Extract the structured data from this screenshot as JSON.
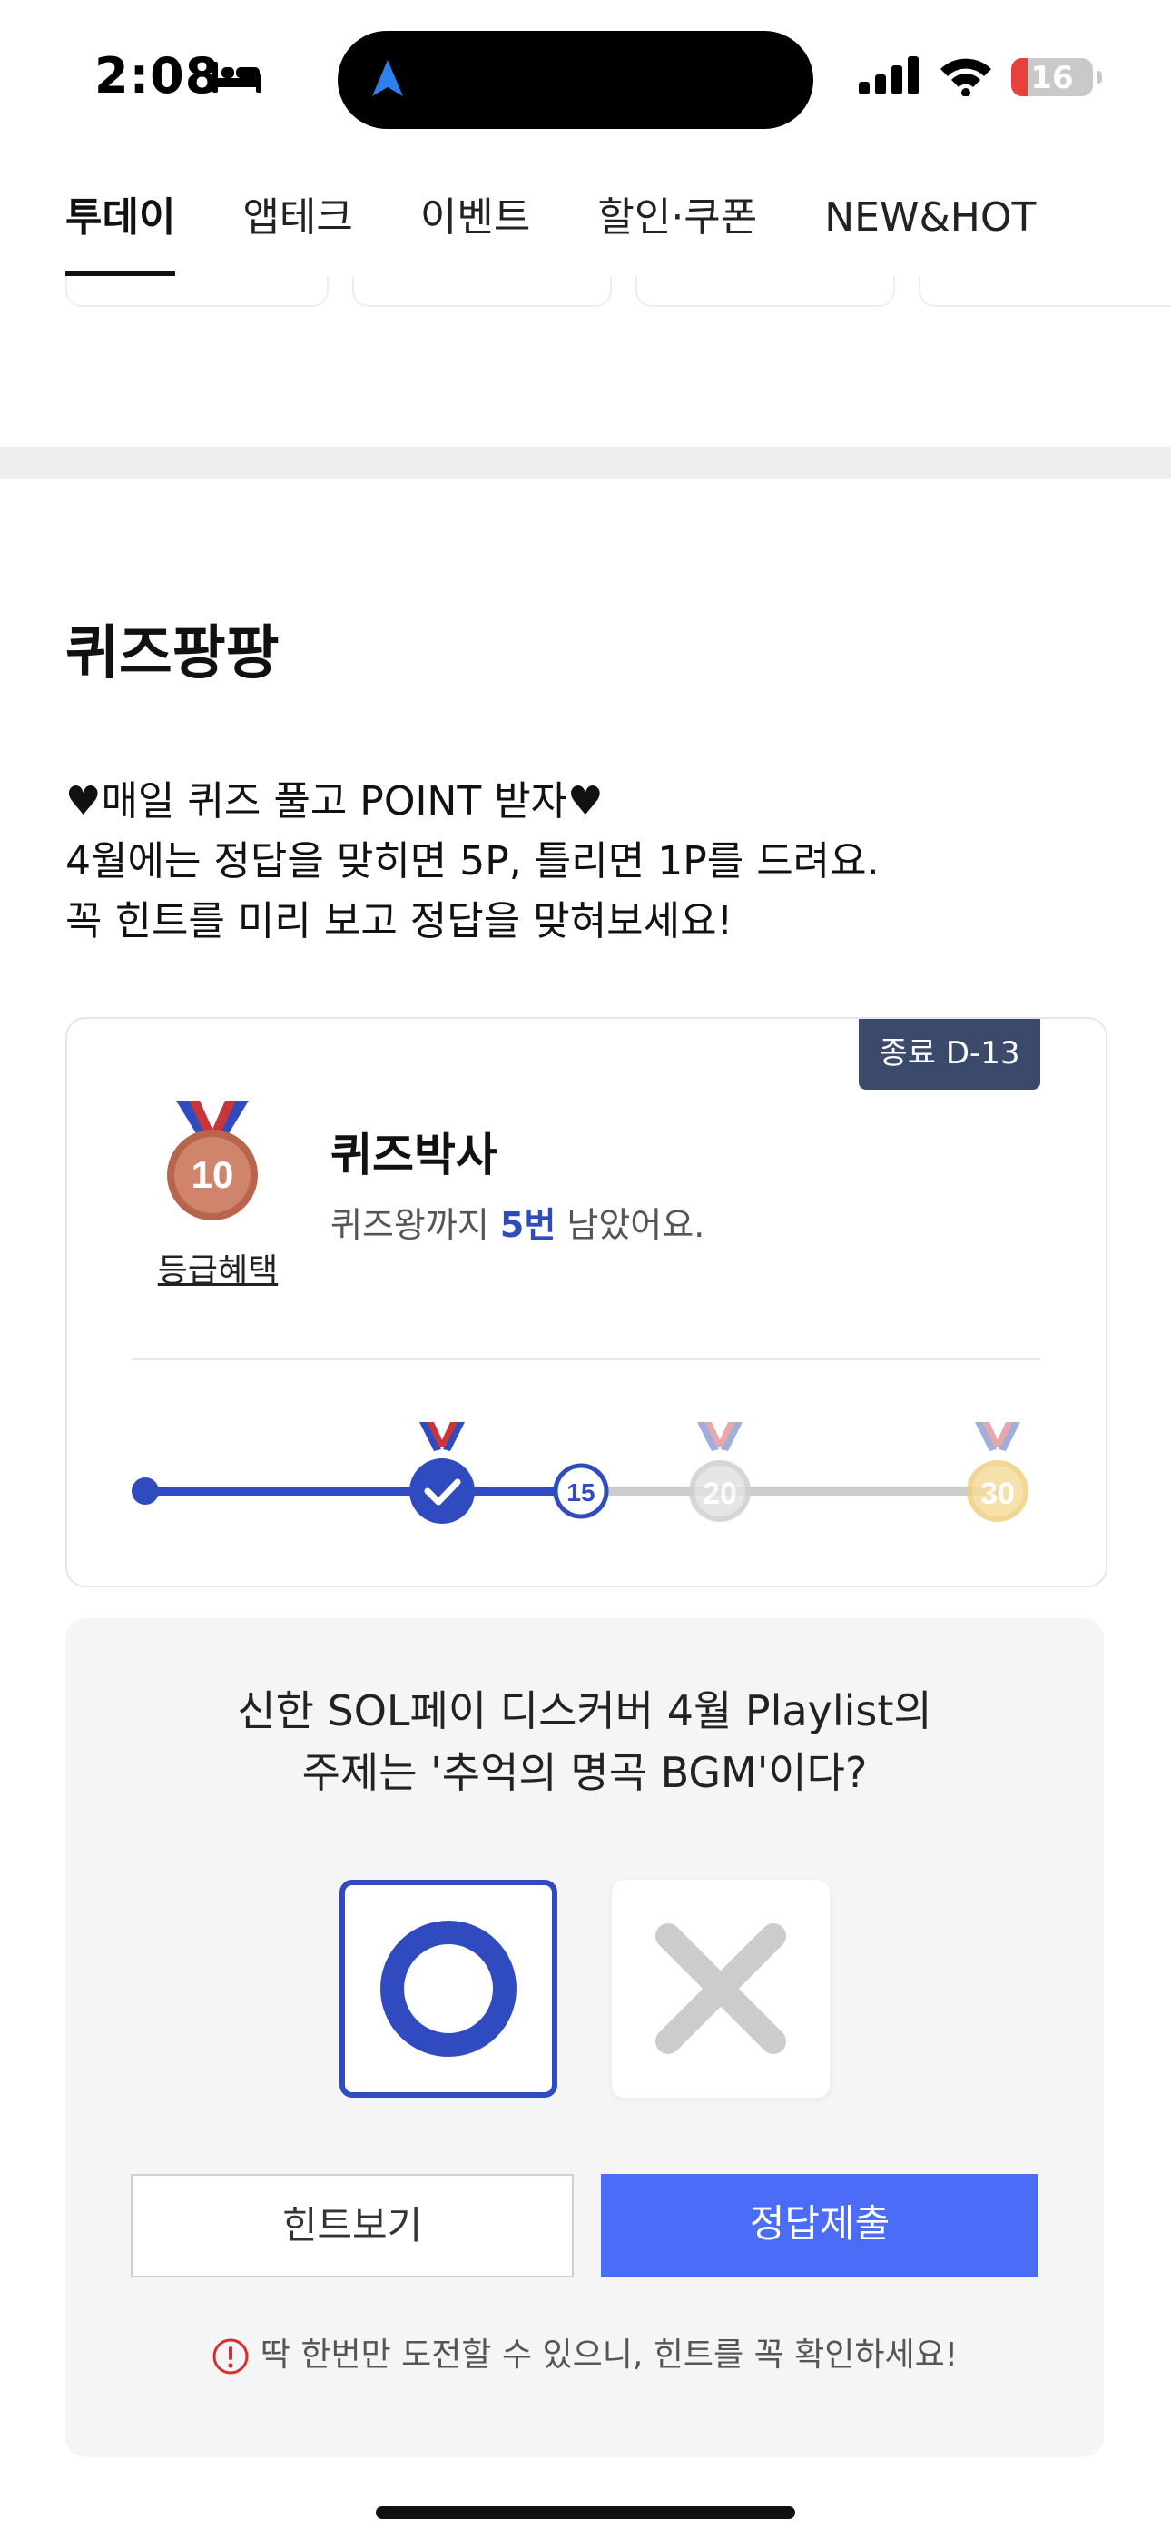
{
  "status": {
    "time": "2:08",
    "battery": "16"
  },
  "tabs": [
    "투데이",
    "앱테크",
    "이벤트",
    "할인·쿠폰",
    "NEW&HOT"
  ],
  "section": {
    "title": "퀴즈팡팡",
    "desc_lines": [
      "♥매일 퀴즈 풀고 POINT 받자♥",
      "4월에는 정답을 맞히면 5P, 틀리면 1P를 드려요.",
      "꼭 힌트를 미리 보고 정답을 맞혀보세요!"
    ]
  },
  "card": {
    "dday": "종료 D-13",
    "medal_number": "10",
    "grade_link": "등급혜택",
    "level_title": "퀴즈박사",
    "level_sub_prefix": "퀴즈왕까지 ",
    "level_sub_highlight": "5번",
    "level_sub_suffix": " 남았어요.",
    "progress": {
      "milestones": [
        "10",
        "15",
        "20",
        "30"
      ],
      "current_label": "15",
      "colors": {
        "active": "#2f4bbf",
        "inactive": "#cccccc",
        "bronze": "#c06a50",
        "silver": "#d0d0d0",
        "gold": "#f3d58a"
      }
    }
  },
  "quiz": {
    "question_lines": [
      "신한 SOL페이 디스커버 4월 Playlist의",
      "주제는 '추억의 명곡 BGM'이다?"
    ],
    "hint_button": "힌트보기",
    "submit_button": "정답제출",
    "warning": "딱 한번만 도전할 수 있으니, 힌트를 꼭 확인하세요!"
  }
}
